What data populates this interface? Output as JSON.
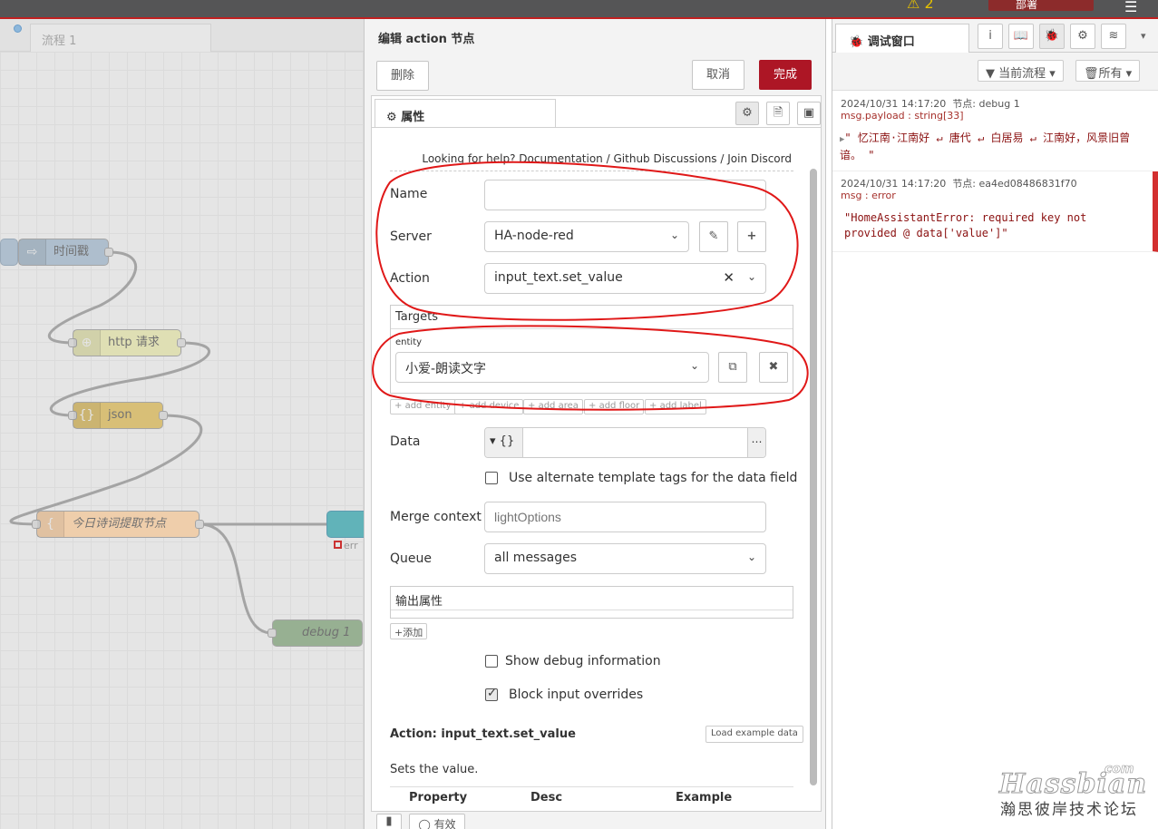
{
  "header": {
    "deploy_label": "部署",
    "warning_count": "2"
  },
  "workspace": {
    "flow_tab": "流程 1",
    "nodes": {
      "timestamp": "时间戳",
      "http": "http 请求",
      "json": "json",
      "function": "今日诗词提取节点",
      "debug": "debug 1",
      "status": "err"
    }
  },
  "dialog": {
    "title": "编辑 action 节点",
    "delete": "删除",
    "cancel": "取消",
    "done": "完成",
    "tab_properties": "属性",
    "help": {
      "prefix": "Looking for help?",
      "documentation": "Documentation",
      "sep": "/",
      "github": "Github Discussions",
      "discord": "Join Discord"
    },
    "name_label": "Name",
    "name_value": "",
    "server_label": "Server",
    "server_value": "HA-node-red",
    "action_label": "Action",
    "action_value": "input_text.set_value",
    "targets_label": "Targets",
    "entity_label": "entity",
    "entity_value": "小爱-朗读文字",
    "add_buttons": [
      "add entity",
      "add device",
      "add area",
      "add floor",
      "add label"
    ],
    "data_label": "Data",
    "data_type": "{}",
    "alt_template_label": "Use alternate template tags for the data field",
    "alt_template_checked": false,
    "merge_label": "Merge context",
    "merge_placeholder": "lightOptions",
    "queue_label": "Queue",
    "queue_value": "all messages",
    "output_label": "输出属性",
    "add_output": "添加",
    "show_debug_label": "Show debug information",
    "show_debug_checked": false,
    "block_label": "Block input overrides",
    "block_checked": true,
    "doc_title": "Action: input_text.set_value",
    "load_example": "Load example data",
    "doc_desc": "Sets the value.",
    "table_headers": [
      "Property",
      "Desc",
      "Example"
    ],
    "footer_enabled": "有效"
  },
  "sidebar": {
    "tab_title": "调试窗口",
    "filter_flow": "当前流程",
    "filter_all": "所有",
    "messages": [
      {
        "time": "2024/10/31 14:17:20",
        "node": "节点: debug 1",
        "topic": "msg.payload : string[33]",
        "body": "\" 忆江南·江南好 ↵ 唐代 ↵ 白居易 ↵ 江南好，风景旧曾谙。 \""
      },
      {
        "time": "2024/10/31 14:17:20",
        "node": "节点: ea4ed08486831f70",
        "topic": "msg : error",
        "body": "\"HomeAssistantError: required key not provided @ data['value']\""
      }
    ]
  },
  "watermark": {
    "latin": "Hassbian",
    "com": "com",
    "chinese": "瀚思彼岸技术论坛"
  }
}
